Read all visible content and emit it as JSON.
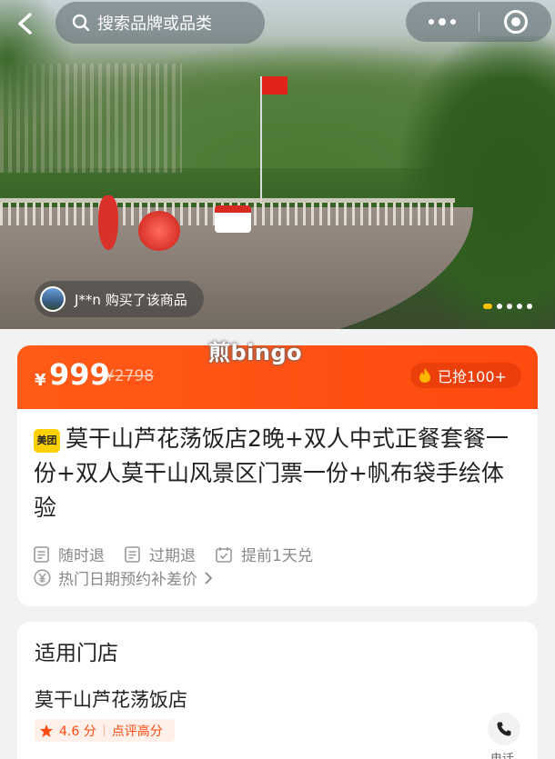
{
  "header": {
    "search_placeholder": "搜索品牌或品类",
    "more_icon": "more-dots-icon",
    "mini_program_icon": "target-circle-icon"
  },
  "hero": {
    "buyer_notice": "J**n 购买了该商品",
    "carousel_total": 5,
    "carousel_active": 1
  },
  "watermark": "煎bingo",
  "price": {
    "currency": "¥",
    "current": "999",
    "original": "¥2798",
    "sold": "已抢100+",
    "accent_color": "#ff4a10"
  },
  "product": {
    "badge": "美团",
    "title": "莫干山芦花荡饭店2晚+双人中式正餐套餐一份+双人莫干山风景区门票一份+帆布袋手绘体验",
    "tags": [
      "随时退",
      "过期退",
      "提前1天兑"
    ],
    "hot_date": "热门日期预约补差价"
  },
  "store": {
    "heading": "适用门店",
    "name": "莫干山芦花荡饭店",
    "score": "4.6 分",
    "score_label": "点评高分",
    "phone_label": "电话"
  }
}
